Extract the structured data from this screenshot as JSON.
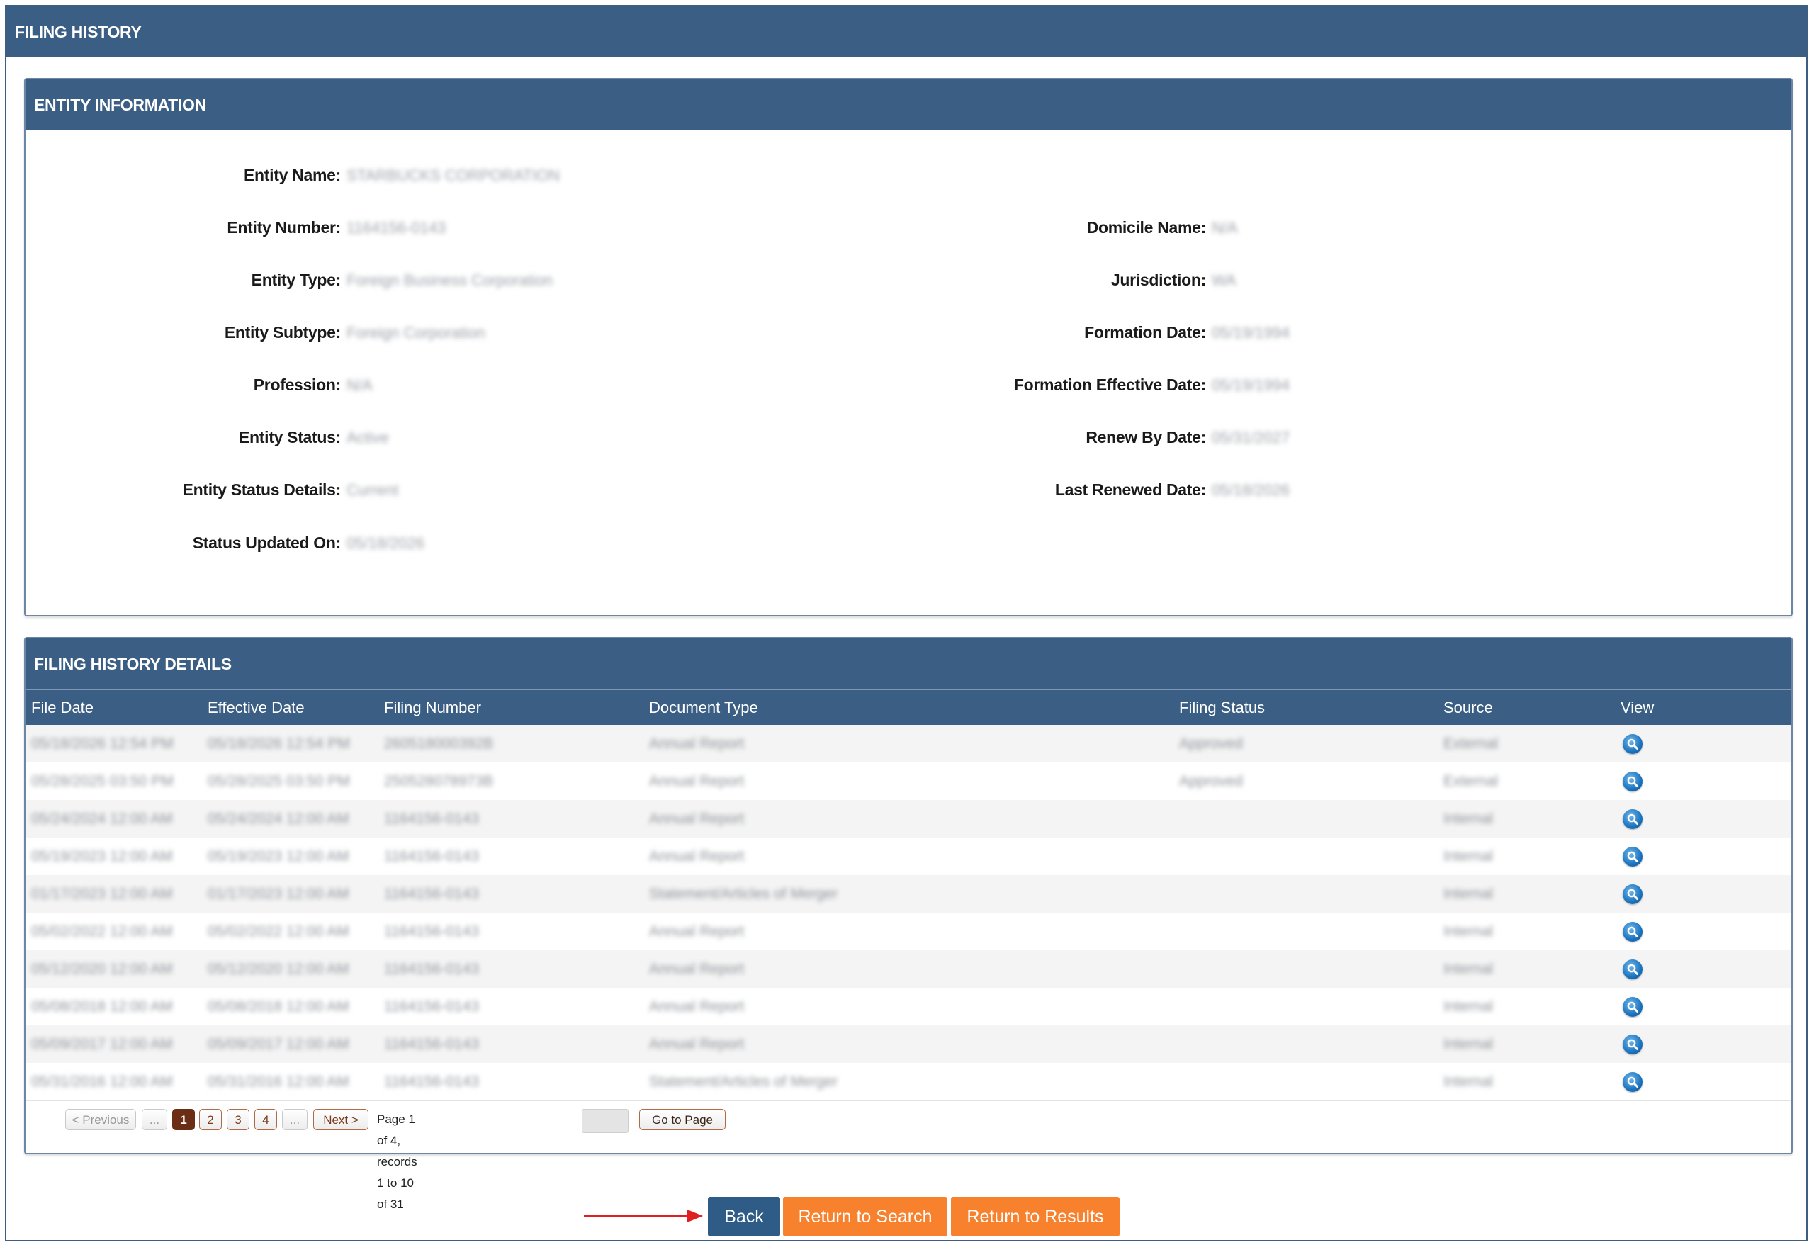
{
  "page_title": "FILING HISTORY",
  "entity_section": {
    "title": "ENTITY INFORMATION",
    "left": [
      {
        "label": "Entity Name:",
        "value": "STARBUCKS CORPORATION"
      },
      {
        "label": "Entity Number:",
        "value": "1164156-0143"
      },
      {
        "label": "Entity Type:",
        "value": "Foreign Business Corporation"
      },
      {
        "label": "Entity Subtype:",
        "value": "Foreign Corporation"
      },
      {
        "label": "Profession:",
        "value": "N/A"
      },
      {
        "label": "Entity Status:",
        "value": "Active"
      },
      {
        "label": "Entity Status Details:",
        "value": "Current"
      },
      {
        "label": "Status Updated On:",
        "value": "05/18/2026"
      }
    ],
    "right": [
      {
        "label": "Domicile Name:",
        "value": "N/A"
      },
      {
        "label": "Jurisdiction:",
        "value": "WA"
      },
      {
        "label": "Formation Date:",
        "value": "05/19/1994"
      },
      {
        "label": "Formation Effective Date:",
        "value": "05/19/1994"
      },
      {
        "label": "Renew By Date:",
        "value": "05/31/2027"
      },
      {
        "label": "Last Renewed Date:",
        "value": "05/18/2026"
      }
    ]
  },
  "filing_section": {
    "title": "FILING HISTORY DETAILS",
    "columns": [
      "File Date",
      "Effective Date",
      "Filing Number",
      "Document Type",
      "Filing Status",
      "Source",
      "View"
    ],
    "rows": [
      {
        "file_date": "05/18/2026 12:54 PM",
        "effective_date": "05/18/2026 12:54 PM",
        "filing_number": "260518000392B",
        "document_type": "Annual Report",
        "filing_status": "Approved",
        "source": "External"
      },
      {
        "file_date": "05/28/2025 03:50 PM",
        "effective_date": "05/28/2025 03:50 PM",
        "filing_number": "250528078973B",
        "document_type": "Annual Report",
        "filing_status": "Approved",
        "source": "External"
      },
      {
        "file_date": "05/24/2024 12:00 AM",
        "effective_date": "05/24/2024 12:00 AM",
        "filing_number": "1164156-0143",
        "document_type": "Annual Report",
        "filing_status": "",
        "source": "Internal"
      },
      {
        "file_date": "05/19/2023 12:00 AM",
        "effective_date": "05/19/2023 12:00 AM",
        "filing_number": "1164156-0143",
        "document_type": "Annual Report",
        "filing_status": "",
        "source": "Internal"
      },
      {
        "file_date": "01/17/2023 12:00 AM",
        "effective_date": "01/17/2023 12:00 AM",
        "filing_number": "1164156-0143",
        "document_type": "Statement/Articles of Merger",
        "filing_status": "",
        "source": "Internal"
      },
      {
        "file_date": "05/02/2022 12:00 AM",
        "effective_date": "05/02/2022 12:00 AM",
        "filing_number": "1164156-0143",
        "document_type": "Annual Report",
        "filing_status": "",
        "source": "Internal"
      },
      {
        "file_date": "05/12/2020 12:00 AM",
        "effective_date": "05/12/2020 12:00 AM",
        "filing_number": "1164156-0143",
        "document_type": "Annual Report",
        "filing_status": "",
        "source": "Internal"
      },
      {
        "file_date": "05/08/2018 12:00 AM",
        "effective_date": "05/08/2018 12:00 AM",
        "filing_number": "1164156-0143",
        "document_type": "Annual Report",
        "filing_status": "",
        "source": "Internal"
      },
      {
        "file_date": "05/09/2017 12:00 AM",
        "effective_date": "05/09/2017 12:00 AM",
        "filing_number": "1164156-0143",
        "document_type": "Annual Report",
        "filing_status": "",
        "source": "Internal"
      },
      {
        "file_date": "05/31/2016 12:00 AM",
        "effective_date": "05/31/2016 12:00 AM",
        "filing_number": "1164156-0143",
        "document_type": "Statement/Articles of Merger",
        "filing_status": "",
        "source": "Internal"
      }
    ],
    "view_icon": "search-magnifier-icon"
  },
  "pagination": {
    "previous": "< Previous",
    "ellipsis_left": "...",
    "pages": [
      "1",
      "2",
      "3",
      "4"
    ],
    "current_page": "1",
    "ellipsis_right": "...",
    "next": "Next >",
    "info": "Page 1 of 4, records 1 to 10 of 31",
    "goto_input_value": "",
    "goto_label": "Go to Page"
  },
  "buttons": {
    "back": "Back",
    "return_search": "Return to Search",
    "return_results": "Return to Results"
  },
  "colors": {
    "header_blue": "#3b5e84",
    "orange": "#f7812d",
    "back_blue": "#2e5c86",
    "active_page": "#6b2e14",
    "annotation_arrow": "#e02020"
  }
}
